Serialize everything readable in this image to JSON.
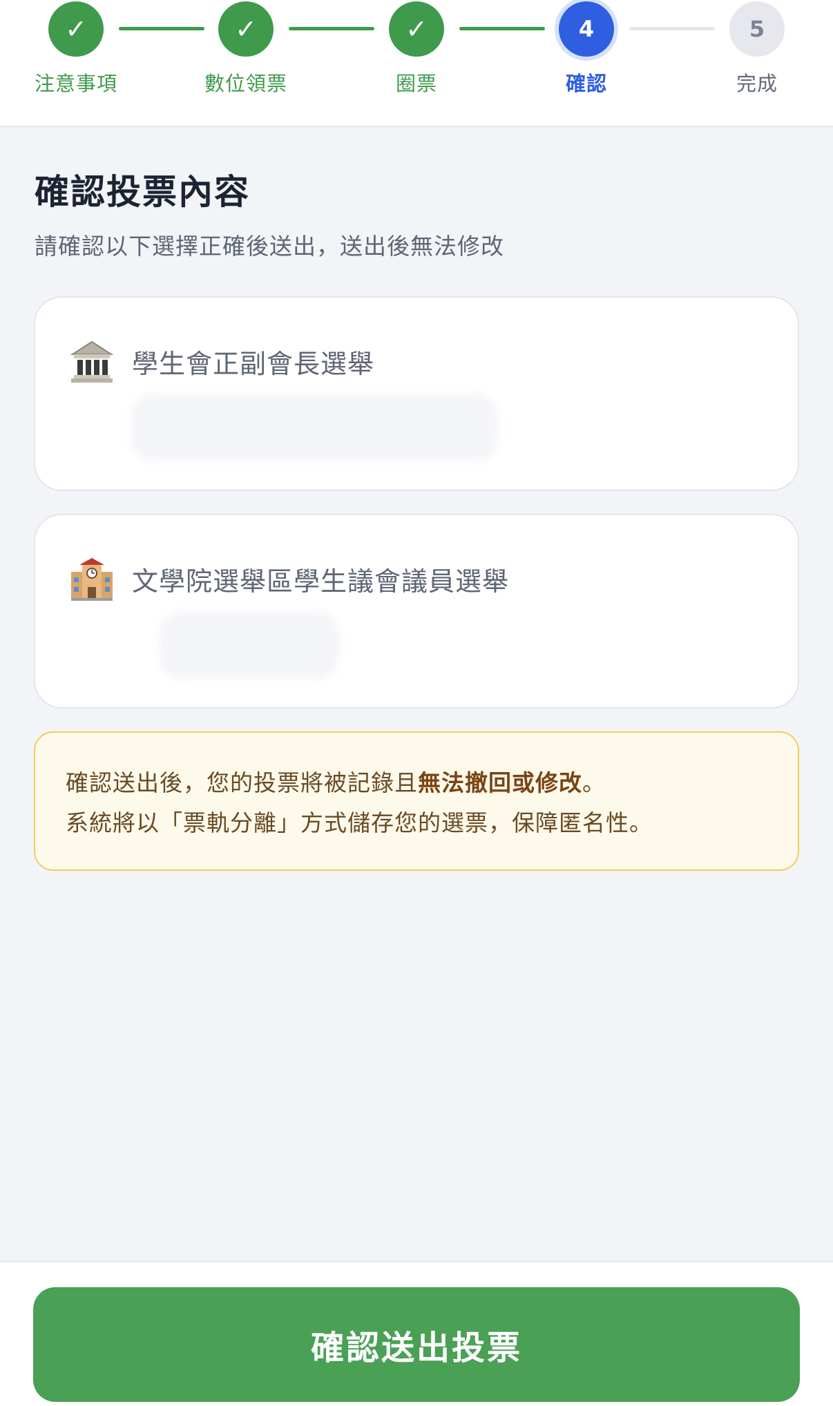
{
  "stepper": {
    "steps": [
      {
        "label": "注意事項",
        "marker": "✓",
        "state": "done"
      },
      {
        "label": "數位領票",
        "marker": "✓",
        "state": "done"
      },
      {
        "label": "圈票",
        "marker": "✓",
        "state": "done"
      },
      {
        "label": "確認",
        "marker": "4",
        "state": "current"
      },
      {
        "label": "完成",
        "marker": "5",
        "state": "todo"
      }
    ]
  },
  "header": {
    "title": "確認投票內容",
    "subtitle": "請確認以下選擇正確後送出，送出後無法修改"
  },
  "races": [
    {
      "icon": "classical-building-icon",
      "name": "學生會正副會長選舉"
    },
    {
      "icon": "school-building-icon",
      "name": "文學院選舉區學生議會議員選舉"
    }
  ],
  "notice": {
    "line1_prefix": "確認送出後，您的投票將被記錄且",
    "line1_strong": "無法撤回或修改",
    "line1_suffix": "。",
    "line2": "系統將以「票軌分離」方式儲存您的選票，保障匿名性。"
  },
  "footer": {
    "submit_label": "確認送出投票"
  },
  "colors": {
    "done": "#3f9a4c",
    "current": "#2f5fe0",
    "button": "#4aa055",
    "notice_border": "#f0cd5a"
  }
}
